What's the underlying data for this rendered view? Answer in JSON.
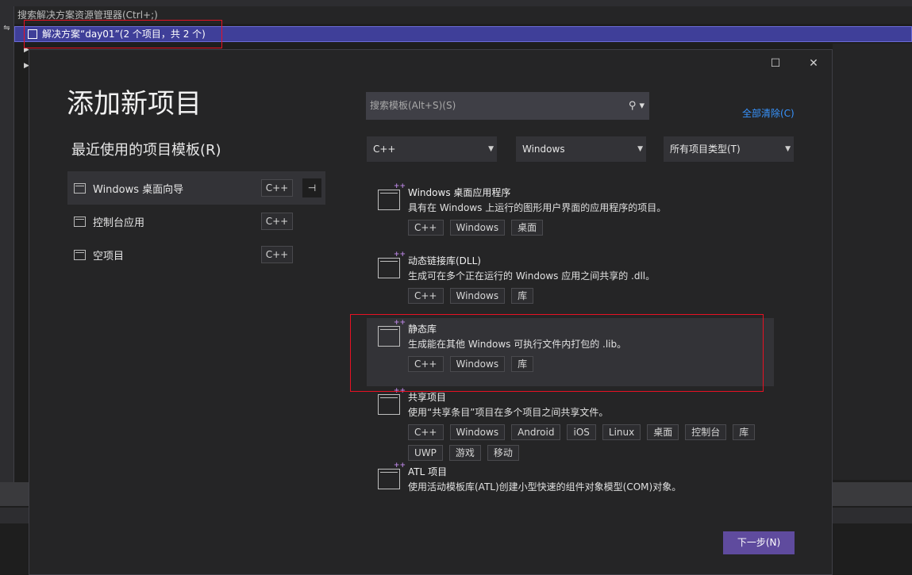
{
  "ide": {
    "search_placeholder": "搜索解决方案资源管理器(Ctrl+;)",
    "solution_label": "解决方案“day01”(2 个项目，共 2 个)",
    "left_glyph": "⇋"
  },
  "dialog": {
    "title": "添加新项目",
    "maximize_icon": "☐",
    "close_icon": "✕",
    "recent_title": "最近使用的项目模板(R)",
    "recent": [
      {
        "label": "Windows 桌面向导",
        "tag": "C++"
      },
      {
        "label": "控制台应用",
        "tag": "C++"
      },
      {
        "label": "空项目",
        "tag": "C++"
      }
    ],
    "pin_icon": "⊣",
    "search_placeholder": "搜索模板(Alt+S)(S)",
    "search_icon": "⚲ ▾",
    "clear_all": "全部清除(C)",
    "filters": {
      "language": "C++",
      "platform": "Windows",
      "project_type": "所有项目类型(T)"
    },
    "templates": [
      {
        "name": "Windows 桌面应用程序",
        "desc": "具有在 Windows 上运行的图形用户界面的应用程序的项目。",
        "tags": [
          "C++",
          "Windows",
          "桌面"
        ]
      },
      {
        "name": "动态链接库(DLL)",
        "desc": "生成可在多个正在运行的 Windows 应用之间共享的 .dll。",
        "tags": [
          "C++",
          "Windows",
          "库"
        ]
      },
      {
        "name": "静态库",
        "desc": "生成能在其他 Windows 可执行文件内打包的 .lib。",
        "tags": [
          "C++",
          "Windows",
          "库"
        ]
      },
      {
        "name": "共享项目",
        "desc": "使用“共享条目”项目在多个项目之间共享文件。",
        "tags": [
          "C++",
          "Windows",
          "Android",
          "iOS",
          "Linux",
          "桌面",
          "控制台",
          "库",
          "UWP",
          "游戏",
          "移动"
        ]
      },
      {
        "name": "ATL 项目",
        "desc": "使用活动模板库(ATL)创建小型快速的组件对象模型(COM)对象。",
        "tags": []
      }
    ],
    "next_button": "下一步(N)"
  }
}
